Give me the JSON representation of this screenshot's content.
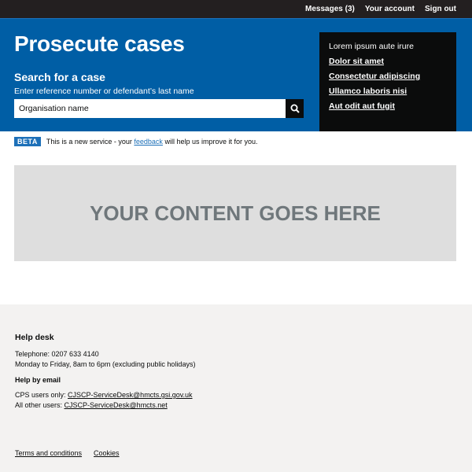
{
  "topnav": {
    "messages": "Messages (3)",
    "account": "Your account",
    "signout": "Sign out"
  },
  "hero": {
    "title": "Prosecute cases",
    "search_heading": "Search for a case",
    "search_hint": "Enter reference number or defendant’s last name",
    "search_value": "Organisation name",
    "search_icon": "search-icon"
  },
  "panel": {
    "title": "Lorem ipsum aute irure",
    "links": [
      "Dolor sit amet",
      "Consectetur adipiscing",
      "Ullamco laboris nisi",
      "Aut odit aut fugit"
    ]
  },
  "beta": {
    "tag": "BETA",
    "text_before": "This is a new service - your ",
    "link": "feedback",
    "text_after": " will help us improve it for you."
  },
  "content": {
    "placeholder": "YOUR CONTENT GOES HERE"
  },
  "footer": {
    "heading": "Help desk",
    "telephone": "Telephone: 0207 633 4140",
    "hours": "Monday to Friday, 8am to 6pm (excluding public holidays)",
    "email_heading": "Help by email",
    "cps_label": "CPS users only: ",
    "cps_email": "CJSCP-ServiceDesk@hmcts.gsi.gov.uk",
    "other_label": "All other users: ",
    "other_email": "CJSCP-ServiceDesk@hmcts.net",
    "links": [
      "Terms and conditions",
      "Cookies"
    ]
  },
  "colors": {
    "header": "#231f20",
    "brand_blue": "#005ea5",
    "link_blue": "#1d70b8",
    "panel": "#0b0c0c",
    "content_box": "#dedede",
    "footer": "#f3f2f1"
  }
}
